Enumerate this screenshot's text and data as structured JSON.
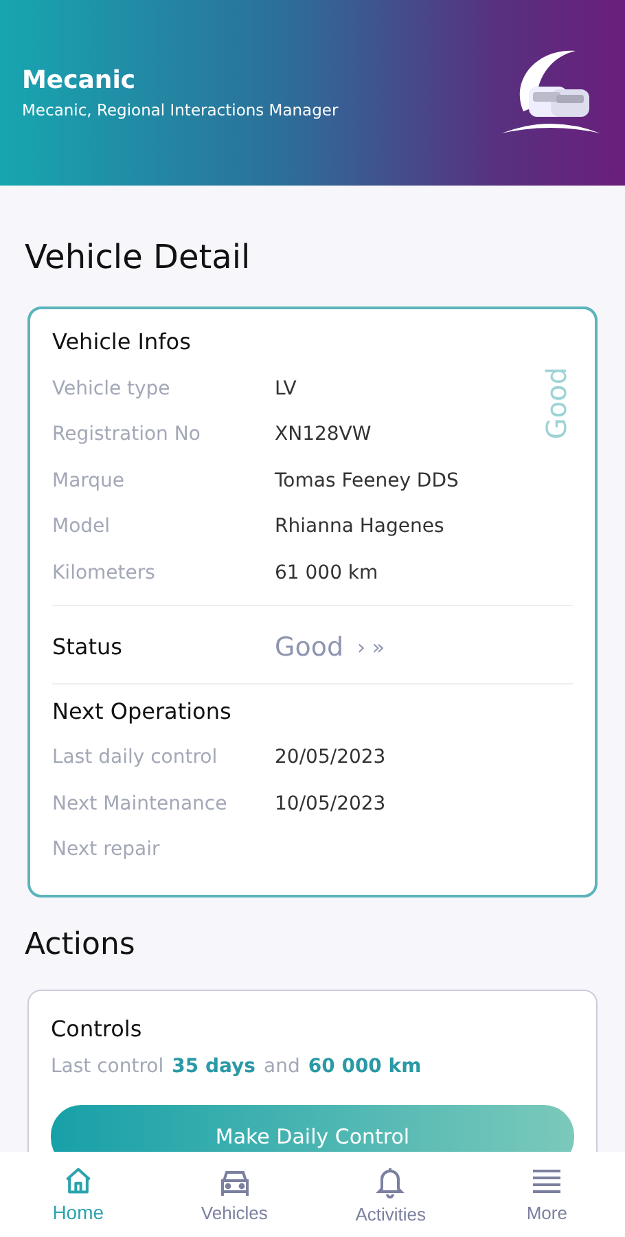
{
  "header": {
    "title": "Mecanic",
    "subtitle": "Mecanic, Regional Interactions Manager"
  },
  "page_title": "Vehicle Detail",
  "vehicle_infos": {
    "title": "Vehicle Infos",
    "badge": "Good",
    "fields": [
      {
        "label": "Vehicle type",
        "value": "LV"
      },
      {
        "label": "Registration No",
        "value": "XN128VW"
      },
      {
        "label": "Marque",
        "value": "Tomas Feeney DDS"
      },
      {
        "label": "Model",
        "value": "Rhianna Hagenes"
      },
      {
        "label": "Kilometers",
        "value": "61 000 km"
      }
    ]
  },
  "status": {
    "label": "Status",
    "value": "Good",
    "chevrons": "› »"
  },
  "next_operations": {
    "title": "Next Operations",
    "fields": [
      {
        "label": "Last daily control",
        "value": "20/05/2023"
      },
      {
        "label": "Next Maintenance",
        "value": "10/05/2023"
      },
      {
        "label": "Next repair"
      }
    ]
  },
  "actions_title": "Actions",
  "controls": {
    "title": "Controls",
    "parts": [
      {
        "text": "Last control",
        "highlight": false
      },
      {
        "text": "35 days",
        "highlight": true
      },
      {
        "text": "and",
        "highlight": false
      },
      {
        "text": "60 000 km",
        "highlight": true
      }
    ],
    "button": "Make Daily Control"
  },
  "nav": [
    {
      "label": "Home",
      "kind": "home",
      "selected": true
    },
    {
      "label": "Vehicles",
      "kind": "car",
      "selected": false
    },
    {
      "label": "Activities",
      "kind": "bell",
      "selected": false
    },
    {
      "label": "More",
      "kind": "menu",
      "selected": false
    }
  ]
}
